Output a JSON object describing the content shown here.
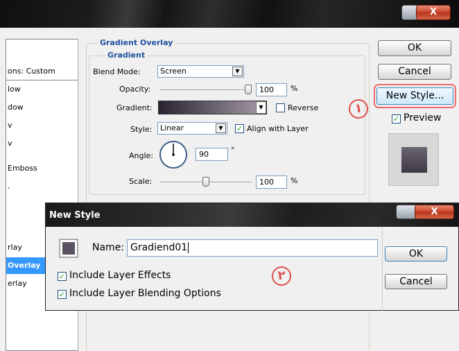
{
  "window": {
    "close_glyph": "X"
  },
  "left_panel": {
    "items": [
      {
        "label": "ons: Custom",
        "selected": false
      },
      {
        "label": "low",
        "selected": false
      },
      {
        "label": "dow",
        "selected": false
      },
      {
        "label": "v",
        "selected": false
      },
      {
        "label": "v",
        "selected": false
      },
      {
        "label": "Emboss",
        "selected": false
      },
      {
        "label": ".",
        "selected": false
      },
      {
        "label": "rlay",
        "selected": false
      },
      {
        "label": "Overlay",
        "selected": true
      },
      {
        "label": "erlay",
        "selected": false
      }
    ]
  },
  "gradient_overlay": {
    "group_title": "Gradient Overlay",
    "subgroup_title": "Gradient",
    "blend_mode_label": "Blend Mode:",
    "blend_mode_value": "Screen",
    "opacity_label": "Opacity:",
    "opacity_value": "100",
    "opacity_unit": "%",
    "opacity_level": 1.0,
    "gradient_label": "Gradient:",
    "reverse_label": "Reverse",
    "reverse_checked": false,
    "style_label": "Style:",
    "style_value": "Linear",
    "align_label": "Align with Layer",
    "align_checked": true,
    "angle_label": "Angle:",
    "angle_value": "90",
    "angle_unit": "°",
    "scale_label": "Scale:",
    "scale_value": "100",
    "scale_unit": "%",
    "scale_level": 0.5
  },
  "right_buttons": {
    "ok_label": "OK",
    "cancel_label": "Cancel",
    "new_style_label": "New Style...",
    "preview_label": "Preview",
    "preview_checked": true
  },
  "new_style_dialog": {
    "title": "New Style",
    "close_glyph": "X",
    "name_label": "Name:",
    "name_value": "Gradiend01",
    "include_effects_label": "Include Layer Effects",
    "include_effects_checked": true,
    "include_blending_label": "Include Layer Blending Options",
    "include_blending_checked": true,
    "ok_label": "OK",
    "cancel_label": "Cancel"
  },
  "annotations": {
    "marker_1": "١",
    "marker_2": "٢"
  },
  "colors": {
    "accent_title": "#1e50a0",
    "selected_bg": "#3399ff",
    "gradient_start": "#2a2230",
    "gradient_end": "#a89eaa",
    "swatch": "#5a5462",
    "annotation": "#e05050"
  }
}
